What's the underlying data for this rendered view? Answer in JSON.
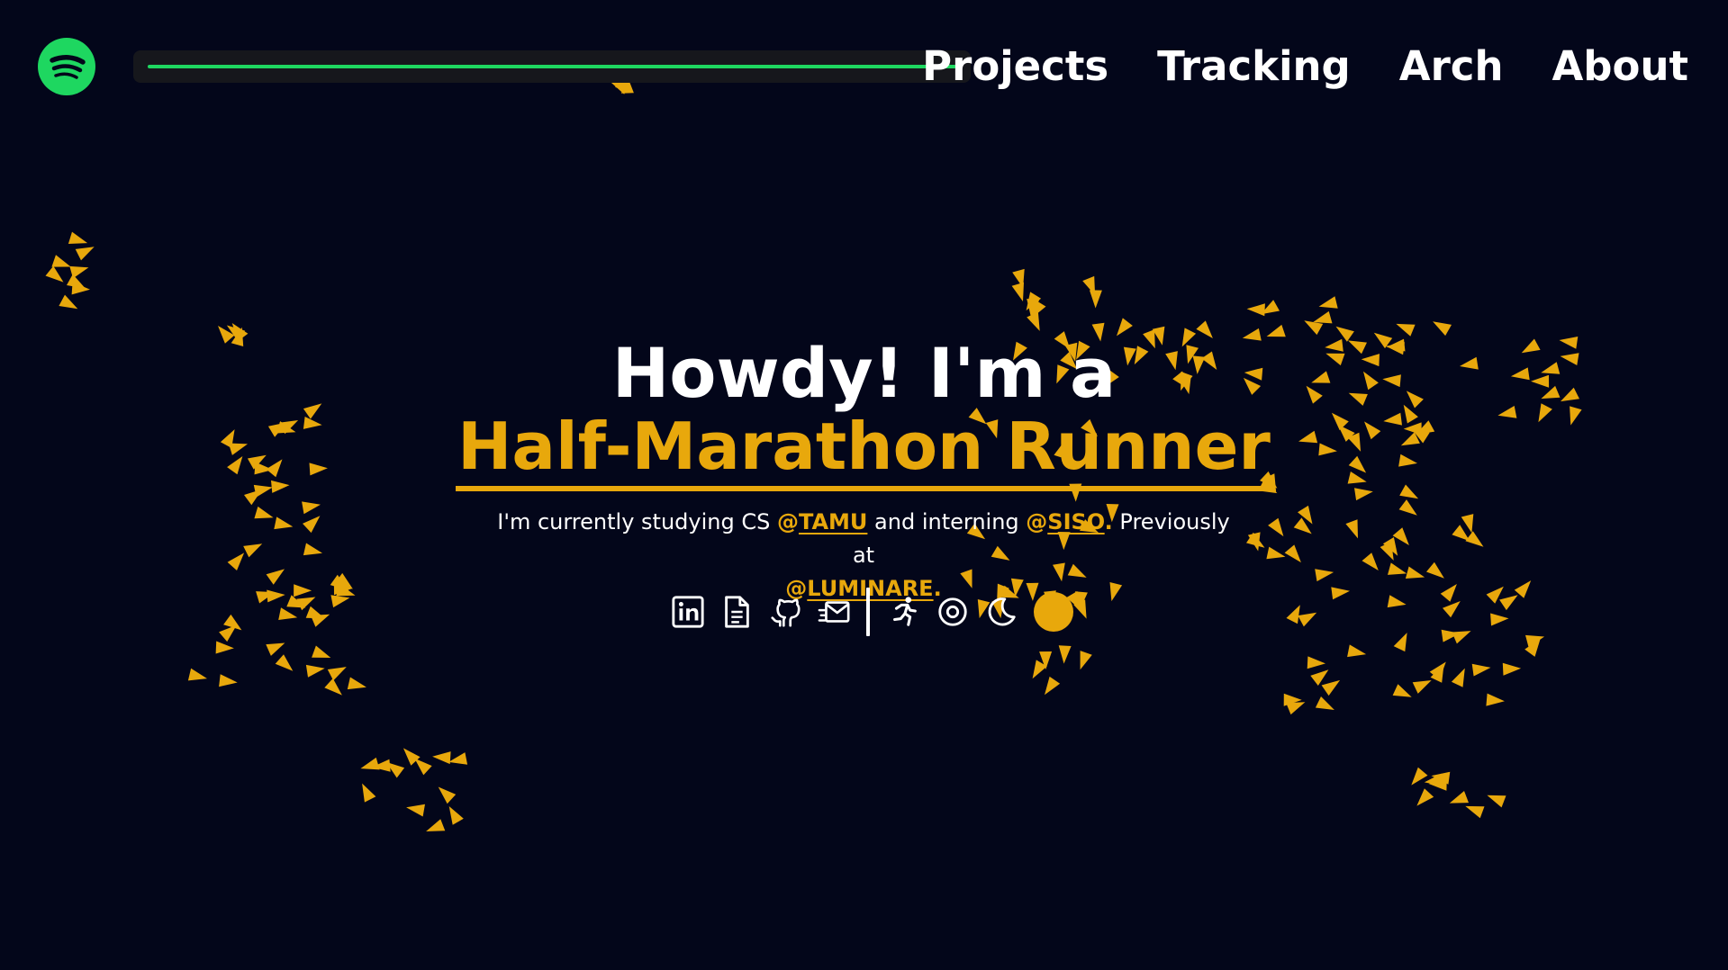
{
  "colors": {
    "background": "#03061a",
    "accent": "#e8a80c",
    "spotify": "#1ed760",
    "text": "#ffffff"
  },
  "header": {
    "spotify_icon": "spotify-icon",
    "player_progress": 1.0,
    "nav": [
      "Projects",
      "Tracking",
      "Arch",
      "About"
    ]
  },
  "hero": {
    "greeting": "Howdy! I'm a",
    "role": "Half-Marathon Runner",
    "bio": {
      "studying": "I'm currently studying CS ",
      "at1": "@",
      "org1": "TAMU",
      "interning": " and interning ",
      "at2": "@",
      "org2": "SISO",
      "period1": ".",
      "previously": " Previously at ",
      "at3": "@",
      "org3": "LUMINARE",
      "period2": "."
    },
    "icons": [
      "linkedin-icon",
      "document-icon",
      "github-icon",
      "mail-icon",
      "runner-icon",
      "target-icon",
      "moon-icon",
      "accent-dot"
    ]
  }
}
